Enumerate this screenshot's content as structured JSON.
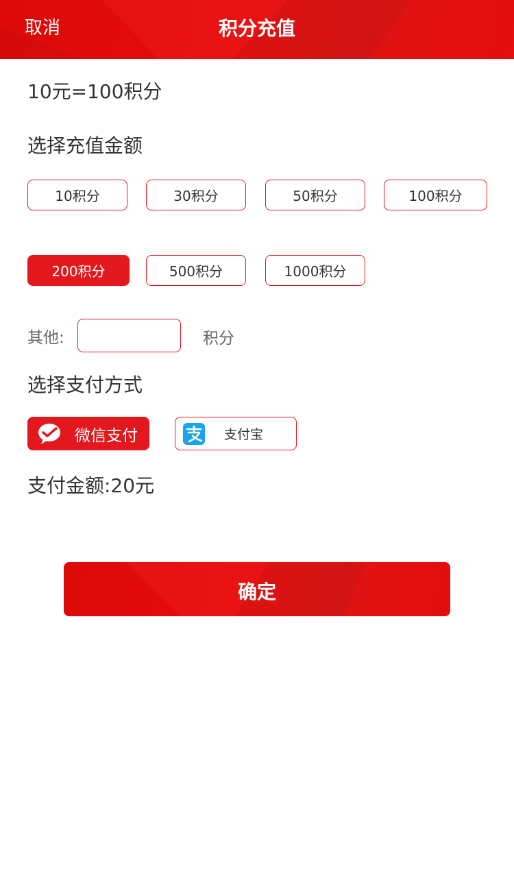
{
  "header": {
    "cancel_label": "取消",
    "title": "积分充值"
  },
  "rate_text": "10元=100积分",
  "amount_section": {
    "label": "选择充值金额",
    "options": [
      "10积分",
      "30积分",
      "50积分",
      "100积分",
      "200积分",
      "500积分",
      "1000积分"
    ],
    "selected": "200积分",
    "other_label": "其他:",
    "other_value": "",
    "other_unit": "积分"
  },
  "payment_section": {
    "label": "选择支付方式",
    "methods": [
      {
        "label": "微信支付",
        "icon": "wechat-pay-icon",
        "selected": true
      },
      {
        "label": "支付宝",
        "icon": "alipay-icon",
        "selected": false
      }
    ]
  },
  "total_text": "支付金额:20元",
  "confirm_label": "确定",
  "colors": {
    "accent": "#e3181e",
    "header_red": "#dd0f0f",
    "alipay_blue": "#1aa4ea",
    "text": "#333333"
  }
}
